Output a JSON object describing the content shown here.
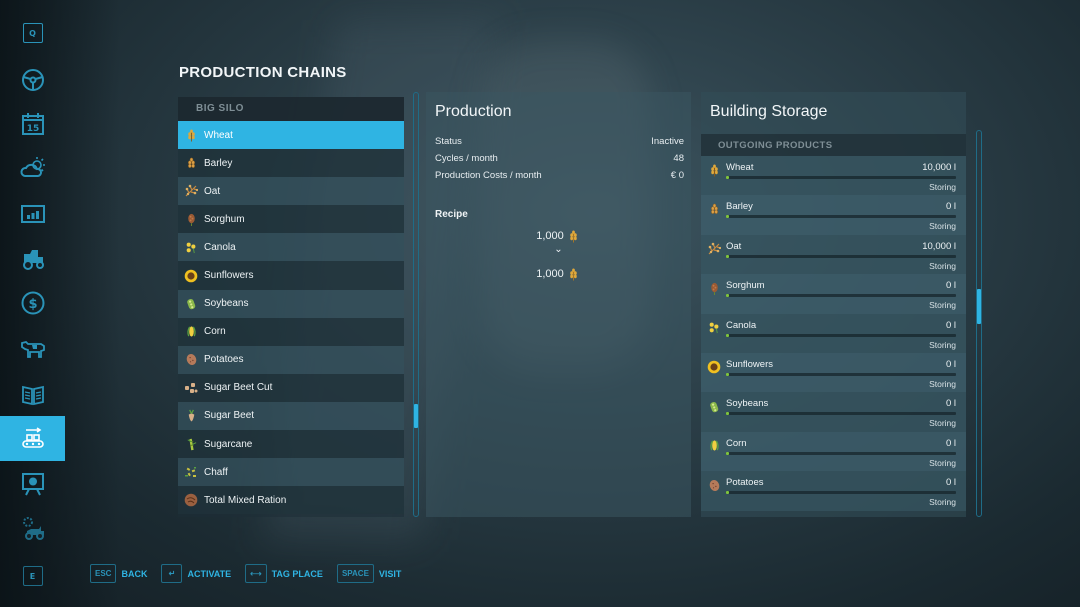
{
  "page": {
    "title": "PRODUCTION CHAINS"
  },
  "sidebar": {
    "items": [
      {
        "key": "Q",
        "icon": "q-key-icon"
      },
      {
        "icon": "steering-wheel-icon",
        "label": "Vehicles"
      },
      {
        "icon": "calendar-icon",
        "text": "15",
        "label": "Calendar"
      },
      {
        "icon": "weather-icon",
        "label": "Weather"
      },
      {
        "icon": "prices-chart-icon",
        "label": "Prices"
      },
      {
        "icon": "tractor-icon",
        "label": "Vehicles"
      },
      {
        "icon": "finances-icon",
        "label": "Finances"
      },
      {
        "icon": "animals-cow-icon",
        "label": "Animals"
      },
      {
        "icon": "contracts-icon",
        "label": "Contracts"
      },
      {
        "icon": "production-icon",
        "label": "Production",
        "active": true
      },
      {
        "icon": "tour-presentation-icon",
        "label": "Help"
      },
      {
        "icon": "settings-vehicle-icon",
        "label": "Settings"
      },
      {
        "key": "E",
        "icon": "e-key-icon"
      }
    ]
  },
  "production_list": {
    "group_header": "BIG SILO",
    "items": [
      {
        "label": "Wheat",
        "icon": "wheat-icon",
        "selected": true
      },
      {
        "label": "Barley",
        "icon": "barley-icon"
      },
      {
        "label": "Oat",
        "icon": "oat-icon"
      },
      {
        "label": "Sorghum",
        "icon": "sorghum-icon"
      },
      {
        "label": "Canola",
        "icon": "canola-icon"
      },
      {
        "label": "Sunflowers",
        "icon": "sunflower-icon"
      },
      {
        "label": "Soybeans",
        "icon": "soybeans-icon"
      },
      {
        "label": "Corn",
        "icon": "corn-icon"
      },
      {
        "label": "Potatoes",
        "icon": "potato-icon"
      },
      {
        "label": "Sugar Beet Cut",
        "icon": "sugar-beet-cut-icon"
      },
      {
        "label": "Sugar Beet",
        "icon": "sugar-beet-icon"
      },
      {
        "label": "Sugarcane",
        "icon": "sugarcane-icon"
      },
      {
        "label": "Chaff",
        "icon": "chaff-icon"
      },
      {
        "label": "Total Mixed Ration",
        "icon": "tmr-icon"
      }
    ],
    "scroll_position": 0.78
  },
  "production": {
    "title": "Production",
    "rows": [
      {
        "label": "Status",
        "value": "Inactive"
      },
      {
        "label": "Cycles / month",
        "value": "48"
      },
      {
        "label": "Production Costs / month",
        "value": "€ 0"
      }
    ],
    "recipe_label": "Recipe",
    "recipe_input": {
      "amount": "1,000",
      "icon": "wheat-icon"
    },
    "recipe_arrow": "⌄",
    "recipe_output": {
      "amount": "1,000",
      "icon": "wheat-icon"
    }
  },
  "storage": {
    "title": "Building Storage",
    "section_header": "OUTGOING PRODUCTS",
    "items": [
      {
        "name": "Wheat",
        "amount": "10,000 l",
        "status": "Storing",
        "fill": 0.01,
        "icon": "wheat-icon"
      },
      {
        "name": "Barley",
        "amount": "0 l",
        "status": "Storing",
        "fill": 0,
        "icon": "barley-icon"
      },
      {
        "name": "Oat",
        "amount": "10,000 l",
        "status": "Storing",
        "fill": 0.01,
        "icon": "oat-icon"
      },
      {
        "name": "Sorghum",
        "amount": "0 l",
        "status": "Storing",
        "fill": 0,
        "icon": "sorghum-icon"
      },
      {
        "name": "Canola",
        "amount": "0 l",
        "status": "Storing",
        "fill": 0,
        "icon": "canola-icon"
      },
      {
        "name": "Sunflowers",
        "amount": "0 l",
        "status": "Storing",
        "fill": 0,
        "icon": "sunflower-icon"
      },
      {
        "name": "Soybeans",
        "amount": "0 l",
        "status": "Storing",
        "fill": 0,
        "icon": "soybeans-icon"
      },
      {
        "name": "Corn",
        "amount": "0 l",
        "status": "Storing",
        "fill": 0,
        "icon": "corn-icon"
      },
      {
        "name": "Potatoes",
        "amount": "0 l",
        "status": "Storing",
        "fill": 0,
        "icon": "potato-icon"
      }
    ],
    "scroll_position": 0.45
  },
  "footer": {
    "hints": [
      {
        "key": "ESC",
        "label": "BACK"
      },
      {
        "key": "↵",
        "label": "ACTIVATE"
      },
      {
        "key": "⟷",
        "label": "TAG PLACE"
      },
      {
        "key": "SPACE",
        "label": "VISIT"
      }
    ]
  },
  "colors": {
    "accent": "#2fb4e3",
    "accent_dark": "#1f6c87",
    "fill_green": "#7fc43d",
    "crop_gold": "#e0a83a"
  }
}
